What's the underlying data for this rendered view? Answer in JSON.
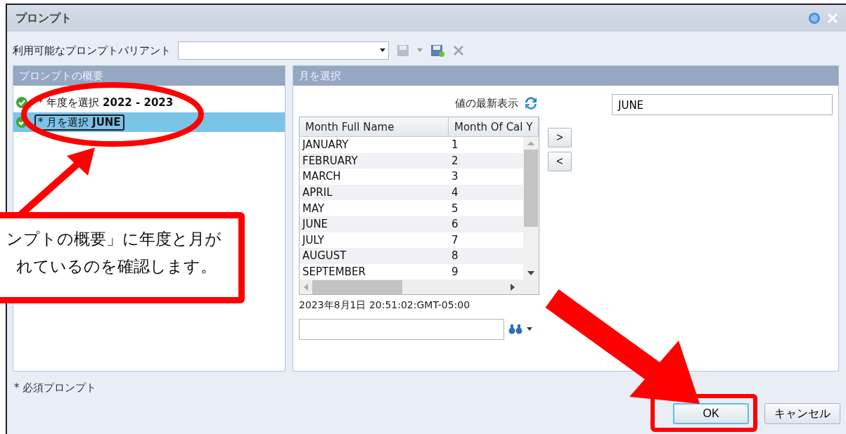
{
  "window": {
    "title": "プロンプト"
  },
  "variant": {
    "label": "利用可能なプロンプトバリアント"
  },
  "summary_panel": {
    "title": "プロンプトの概要",
    "items": [
      {
        "label": "* 年度を選択 **2022 - 2023**",
        "selected": false
      },
      {
        "label": "* 月を選択 **JUNE**",
        "selected": true
      }
    ]
  },
  "month_panel": {
    "title": "月を選択",
    "refresh_label": "値の最新表示",
    "columns": [
      "Month Full Name",
      "Month Of Cal Y"
    ],
    "rows": [
      [
        "JANUARY",
        "1"
      ],
      [
        "FEBRUARY",
        "2"
      ],
      [
        "MARCH",
        "3"
      ],
      [
        "APRIL",
        "4"
      ],
      [
        "MAY",
        "5"
      ],
      [
        "JUNE",
        "6"
      ],
      [
        "JULY",
        "7"
      ],
      [
        "AUGUST",
        "8"
      ],
      [
        "SEPTEMBER",
        "9"
      ]
    ],
    "move_buttons": [
      ">",
      "<"
    ],
    "timestamp": "2023年8月1日 20:51:02:GMT-05:00",
    "selected_values": [
      "JUNE"
    ]
  },
  "footer": {
    "note": "* 必須プロンプト"
  },
  "buttons": [
    {
      "label": "OK",
      "kind": "primary"
    },
    {
      "label": "キャンセル",
      "kind": "secondary"
    }
  ],
  "annotation": {
    "callout_lines": [
      "ンプトの概要」に年度と月が",
      "れているのを確認します。"
    ]
  }
}
